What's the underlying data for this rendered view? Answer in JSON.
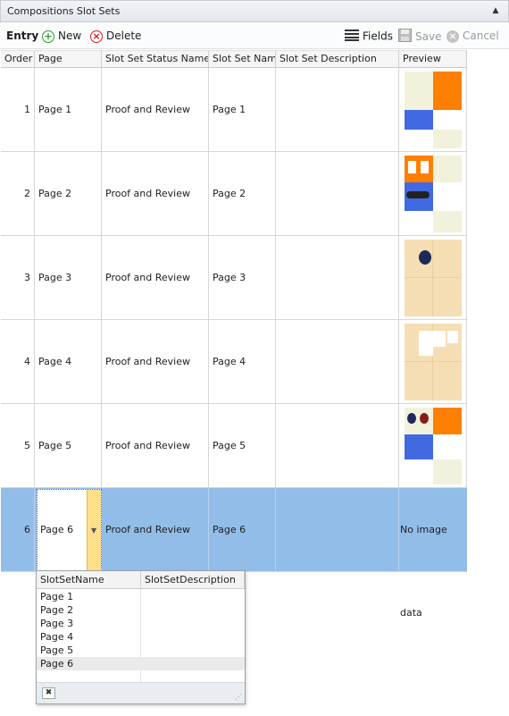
{
  "panel": {
    "title": "Compositions Slot Sets",
    "collapse_icon": "chevron-up-icon"
  },
  "toolbar": {
    "entry_label": "Entry",
    "new_label": "New",
    "delete_label": "Delete",
    "fields_label": "Fields",
    "save_label": "Save",
    "cancel_label": "Cancel"
  },
  "grid": {
    "columns": [
      "Order",
      "Page",
      "Slot Set Status Name",
      "Slot Set Name",
      "Slot Set Description",
      "Preview"
    ],
    "rows": [
      {
        "order": "1",
        "page": "Page 1",
        "status": "Proof and Review",
        "name": "Page 1",
        "description": ""
      },
      {
        "order": "2",
        "page": "Page 2",
        "status": "Proof and Review",
        "name": "Page 2",
        "description": ""
      },
      {
        "order": "3",
        "page": "Page 3",
        "status": "Proof and Review",
        "name": "Page 3",
        "description": ""
      },
      {
        "order": "4",
        "page": "Page 4",
        "status": "Proof and Review",
        "name": "Page 4",
        "description": ""
      },
      {
        "order": "5",
        "page": "Page 5",
        "status": "Proof and Review",
        "name": "Page 5",
        "description": ""
      },
      {
        "order": "6",
        "page": "Page 6",
        "status": "Proof and Review",
        "name": "Page 6",
        "description": "",
        "preview_text": "No image data"
      }
    ],
    "selected_row": 6
  },
  "dropdown": {
    "columns": [
      "SlotSetName",
      "SlotSetDescription"
    ],
    "items": [
      "Page 1",
      "Page 2",
      "Page 3",
      "Page 4",
      "Page 5",
      "Page 6"
    ],
    "selected_item": "Page 6"
  },
  "colors": {
    "selection": "#93bde9",
    "orange": "#ff7f00",
    "blue": "#4169e1",
    "cream": "#f2f2dc",
    "tan": "#f5deb3"
  }
}
